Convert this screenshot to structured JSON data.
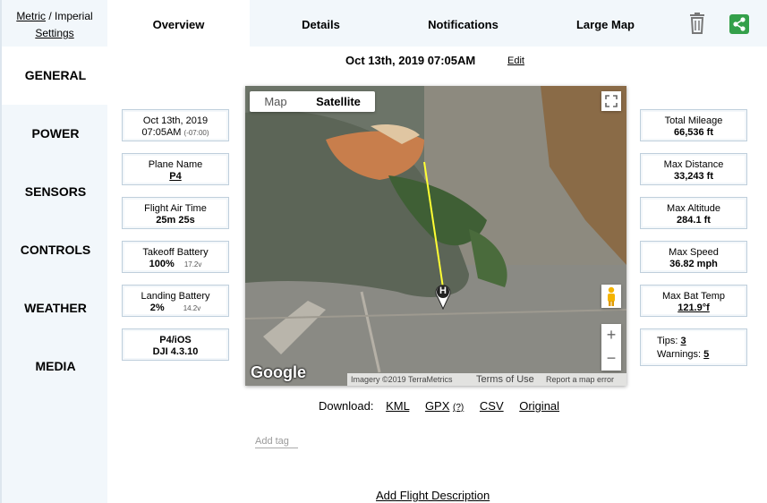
{
  "units": {
    "metric": "Metric",
    "separator": " / ",
    "imperial": "Imperial",
    "settings": "Settings"
  },
  "sidebar": {
    "items": [
      {
        "label": "GENERAL"
      },
      {
        "label": "POWER"
      },
      {
        "label": "SENSORS"
      },
      {
        "label": "CONTROLS"
      },
      {
        "label": "WEATHER"
      },
      {
        "label": "MEDIA"
      }
    ]
  },
  "tabs": [
    {
      "label": "Overview"
    },
    {
      "label": "Details"
    },
    {
      "label": "Notifications"
    },
    {
      "label": "Large Map"
    }
  ],
  "header": {
    "date": "Oct 13th, 2019 07:05AM",
    "edit": "Edit"
  },
  "left_cards": {
    "datetime": {
      "date": "Oct 13th, 2019",
      "time": "07:05AM",
      "tz": "(-07:00)"
    },
    "plane": {
      "title": "Plane Name",
      "value": "P4"
    },
    "airtime": {
      "title": "Flight Air Time",
      "value": "25m 25s"
    },
    "takeoff": {
      "title": "Takeoff Battery",
      "value": "100%",
      "volt": "17.2v"
    },
    "landing": {
      "title": "Landing Battery",
      "value": "2%",
      "volt": "14.2v"
    },
    "app": {
      "line1": "P4/iOS",
      "line2": "DJI 4.3.10"
    }
  },
  "right_cards": {
    "mileage": {
      "title": "Total Mileage",
      "value": "66,536 ft"
    },
    "distance": {
      "title": "Max Distance",
      "value": "33,243 ft"
    },
    "altitude": {
      "title": "Max Altitude",
      "value": "284.1 ft"
    },
    "speed": {
      "title": "Max Speed",
      "value": "36.82 mph"
    },
    "battemp": {
      "title": "Max Bat Temp",
      "value": "121.9°f"
    },
    "tips": {
      "tips_label": "Tips:",
      "tips_value": "3",
      "warn_label": "Warnings:",
      "warn_value": "5"
    }
  },
  "map": {
    "type_map": "Map",
    "type_satellite": "Satellite",
    "home_marker": "H",
    "zoom_in": "+",
    "zoom_out": "−",
    "logo": "Google",
    "imagery": "Imagery ©2019 TerraMetrics",
    "terms": "Terms of Use",
    "report": "Report a map error"
  },
  "download": {
    "label": "Download:",
    "kml": "KML",
    "gpx": "GPX",
    "gpx_help": "(?)",
    "csv": "CSV",
    "original": "Original"
  },
  "tag_placeholder": "Add tag",
  "description_link": "Add Flight Description",
  "colors": {
    "share_green": "#34a04a",
    "flight_path": "#ffff33",
    "panel_bg": "#f2f7fb"
  },
  "icons": {
    "trash": "trash-icon",
    "share": "share-icon",
    "fullscreen": "fullscreen-icon",
    "pegman": "pegman-icon"
  }
}
